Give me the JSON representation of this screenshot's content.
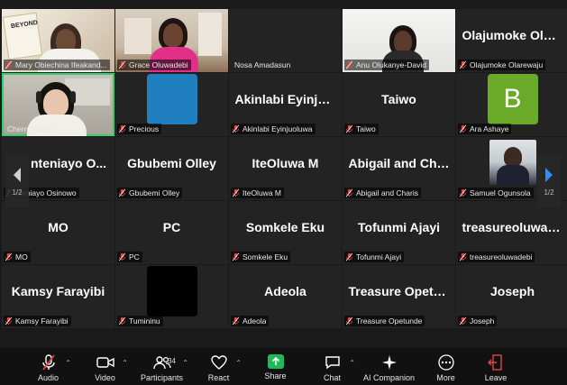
{
  "colors": {
    "active_speaker": "#2dd36f",
    "muted_mic": "#e04646",
    "share": "#1fb95a",
    "avatar_b": "#6aaa28",
    "avatar_precious": "#1f7fbf"
  },
  "tiles": [
    {
      "footer": "Mary Obiechina Ifeakand..."
    },
    {
      "footer": "Grace Oluwadebi"
    },
    {
      "footer": "Nosa Amadasun"
    },
    {
      "footer": "Anu Olukanye-David"
    },
    {
      "big": "Olajumoke Olar...",
      "footer": "Olajumoke Olarewaju"
    },
    {
      "footer": "Cherry Wang"
    },
    {
      "footer": "Precious"
    },
    {
      "big": "Akinlabi Eyinju...",
      "footer": "Akinlabi Eyinjuoluwa"
    },
    {
      "big": "Taiwo",
      "footer": "Taiwo"
    },
    {
      "avatar_letter": "B",
      "footer": "Ara Ashaye"
    },
    {
      "big": "nteniayo O...",
      "footer": "nteniayo Osinowo"
    },
    {
      "big": "Gbubemi Olley",
      "footer": "Gbubemi Olley"
    },
    {
      "big": "IteOluwa M",
      "footer": "IteOluwa M"
    },
    {
      "big": "Abigail and Cha...",
      "footer": "Abigail and Charis"
    },
    {
      "footer": "Samuel Ogunsola"
    },
    {
      "big": "MO",
      "footer": "MO"
    },
    {
      "big": "PC",
      "footer": "PC"
    },
    {
      "big": "Somkele Eku",
      "footer": "Somkele Eku"
    },
    {
      "big": "Tofunmi Ajayi",
      "footer": "Tofunmi Ajayi"
    },
    {
      "big": "treasureoluwad...",
      "footer": "treasureoluwadebi"
    },
    {
      "big": "Kamsy Farayibi",
      "footer": "Kamsy Farayibi"
    },
    {
      "footer": "Tumininu"
    },
    {
      "big": "Adeola",
      "footer": "Adeola"
    },
    {
      "big": "Treasure Opetu...",
      "footer": "Treasure Opetunde"
    },
    {
      "big": "Joseph",
      "footer": "Joseph"
    }
  ],
  "pager": {
    "left": "1/2",
    "right": "1/2"
  },
  "toolbar": {
    "audio": "Audio",
    "video": "Video",
    "participants": "Participants",
    "participants_count": "34",
    "react": "React",
    "share": "Share",
    "chat": "Chat",
    "ai_companion": "AI Companion",
    "more": "More",
    "leave": "Leave"
  },
  "icons": [
    "mic-muted-icon",
    "video-icon",
    "participants-icon",
    "heart-icon",
    "share-arrow-icon",
    "chat-icon",
    "sparkle-icon",
    "more-dots-icon",
    "leave-icon",
    "chevron-left-icon",
    "chevron-right-icon"
  ]
}
